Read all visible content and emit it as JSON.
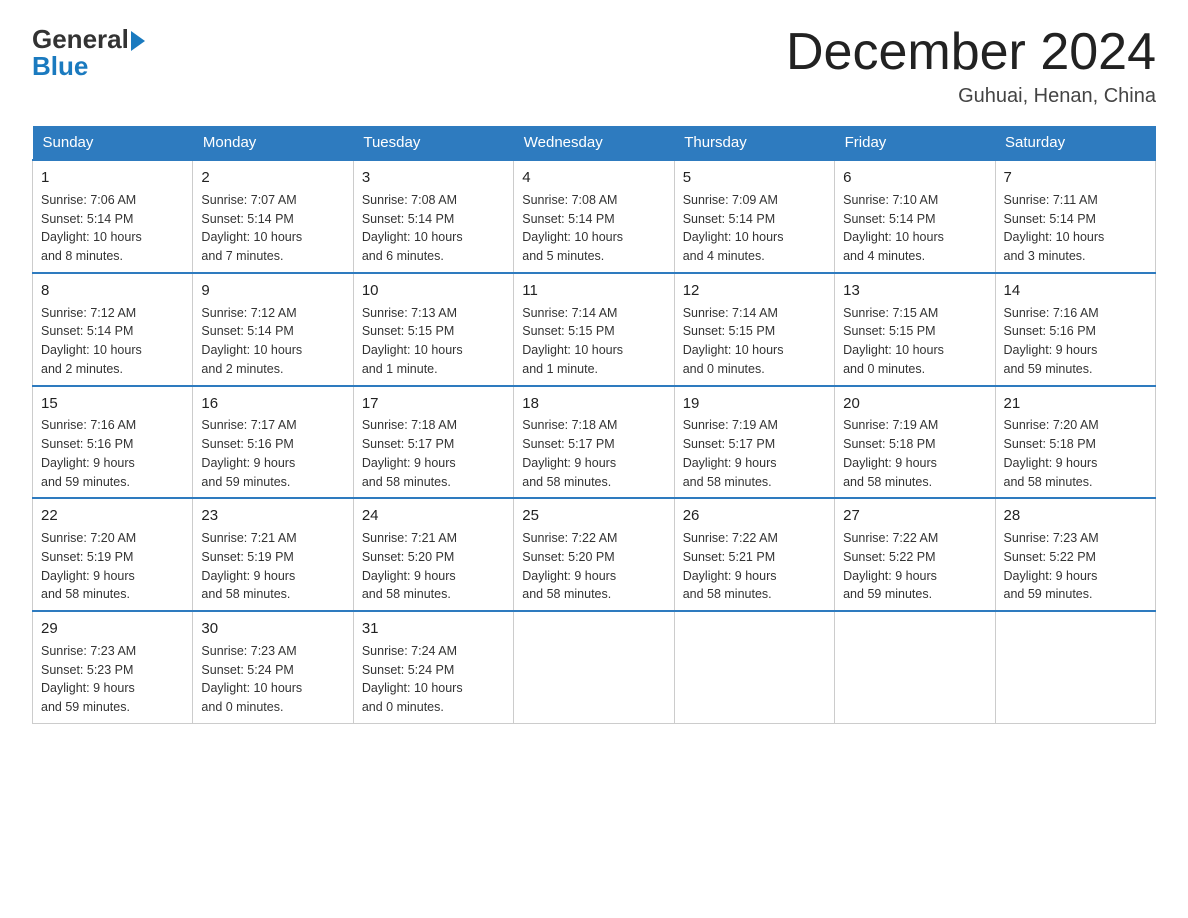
{
  "logo": {
    "line1": "General",
    "arrow": true,
    "line2": "Blue"
  },
  "title": "December 2024",
  "subtitle": "Guhuai, Henan, China",
  "days_of_week": [
    "Sunday",
    "Monday",
    "Tuesday",
    "Wednesday",
    "Thursday",
    "Friday",
    "Saturday"
  ],
  "weeks": [
    [
      {
        "num": "1",
        "info": "Sunrise: 7:06 AM\nSunset: 5:14 PM\nDaylight: 10 hours\nand 8 minutes."
      },
      {
        "num": "2",
        "info": "Sunrise: 7:07 AM\nSunset: 5:14 PM\nDaylight: 10 hours\nand 7 minutes."
      },
      {
        "num": "3",
        "info": "Sunrise: 7:08 AM\nSunset: 5:14 PM\nDaylight: 10 hours\nand 6 minutes."
      },
      {
        "num": "4",
        "info": "Sunrise: 7:08 AM\nSunset: 5:14 PM\nDaylight: 10 hours\nand 5 minutes."
      },
      {
        "num": "5",
        "info": "Sunrise: 7:09 AM\nSunset: 5:14 PM\nDaylight: 10 hours\nand 4 minutes."
      },
      {
        "num": "6",
        "info": "Sunrise: 7:10 AM\nSunset: 5:14 PM\nDaylight: 10 hours\nand 4 minutes."
      },
      {
        "num": "7",
        "info": "Sunrise: 7:11 AM\nSunset: 5:14 PM\nDaylight: 10 hours\nand 3 minutes."
      }
    ],
    [
      {
        "num": "8",
        "info": "Sunrise: 7:12 AM\nSunset: 5:14 PM\nDaylight: 10 hours\nand 2 minutes."
      },
      {
        "num": "9",
        "info": "Sunrise: 7:12 AM\nSunset: 5:14 PM\nDaylight: 10 hours\nand 2 minutes."
      },
      {
        "num": "10",
        "info": "Sunrise: 7:13 AM\nSunset: 5:15 PM\nDaylight: 10 hours\nand 1 minute."
      },
      {
        "num": "11",
        "info": "Sunrise: 7:14 AM\nSunset: 5:15 PM\nDaylight: 10 hours\nand 1 minute."
      },
      {
        "num": "12",
        "info": "Sunrise: 7:14 AM\nSunset: 5:15 PM\nDaylight: 10 hours\nand 0 minutes."
      },
      {
        "num": "13",
        "info": "Sunrise: 7:15 AM\nSunset: 5:15 PM\nDaylight: 10 hours\nand 0 minutes."
      },
      {
        "num": "14",
        "info": "Sunrise: 7:16 AM\nSunset: 5:16 PM\nDaylight: 9 hours\nand 59 minutes."
      }
    ],
    [
      {
        "num": "15",
        "info": "Sunrise: 7:16 AM\nSunset: 5:16 PM\nDaylight: 9 hours\nand 59 minutes."
      },
      {
        "num": "16",
        "info": "Sunrise: 7:17 AM\nSunset: 5:16 PM\nDaylight: 9 hours\nand 59 minutes."
      },
      {
        "num": "17",
        "info": "Sunrise: 7:18 AM\nSunset: 5:17 PM\nDaylight: 9 hours\nand 58 minutes."
      },
      {
        "num": "18",
        "info": "Sunrise: 7:18 AM\nSunset: 5:17 PM\nDaylight: 9 hours\nand 58 minutes."
      },
      {
        "num": "19",
        "info": "Sunrise: 7:19 AM\nSunset: 5:17 PM\nDaylight: 9 hours\nand 58 minutes."
      },
      {
        "num": "20",
        "info": "Sunrise: 7:19 AM\nSunset: 5:18 PM\nDaylight: 9 hours\nand 58 minutes."
      },
      {
        "num": "21",
        "info": "Sunrise: 7:20 AM\nSunset: 5:18 PM\nDaylight: 9 hours\nand 58 minutes."
      }
    ],
    [
      {
        "num": "22",
        "info": "Sunrise: 7:20 AM\nSunset: 5:19 PM\nDaylight: 9 hours\nand 58 minutes."
      },
      {
        "num": "23",
        "info": "Sunrise: 7:21 AM\nSunset: 5:19 PM\nDaylight: 9 hours\nand 58 minutes."
      },
      {
        "num": "24",
        "info": "Sunrise: 7:21 AM\nSunset: 5:20 PM\nDaylight: 9 hours\nand 58 minutes."
      },
      {
        "num": "25",
        "info": "Sunrise: 7:22 AM\nSunset: 5:20 PM\nDaylight: 9 hours\nand 58 minutes."
      },
      {
        "num": "26",
        "info": "Sunrise: 7:22 AM\nSunset: 5:21 PM\nDaylight: 9 hours\nand 58 minutes."
      },
      {
        "num": "27",
        "info": "Sunrise: 7:22 AM\nSunset: 5:22 PM\nDaylight: 9 hours\nand 59 minutes."
      },
      {
        "num": "28",
        "info": "Sunrise: 7:23 AM\nSunset: 5:22 PM\nDaylight: 9 hours\nand 59 minutes."
      }
    ],
    [
      {
        "num": "29",
        "info": "Sunrise: 7:23 AM\nSunset: 5:23 PM\nDaylight: 9 hours\nand 59 minutes."
      },
      {
        "num": "30",
        "info": "Sunrise: 7:23 AM\nSunset: 5:24 PM\nDaylight: 10 hours\nand 0 minutes."
      },
      {
        "num": "31",
        "info": "Sunrise: 7:24 AM\nSunset: 5:24 PM\nDaylight: 10 hours\nand 0 minutes."
      },
      null,
      null,
      null,
      null
    ]
  ]
}
